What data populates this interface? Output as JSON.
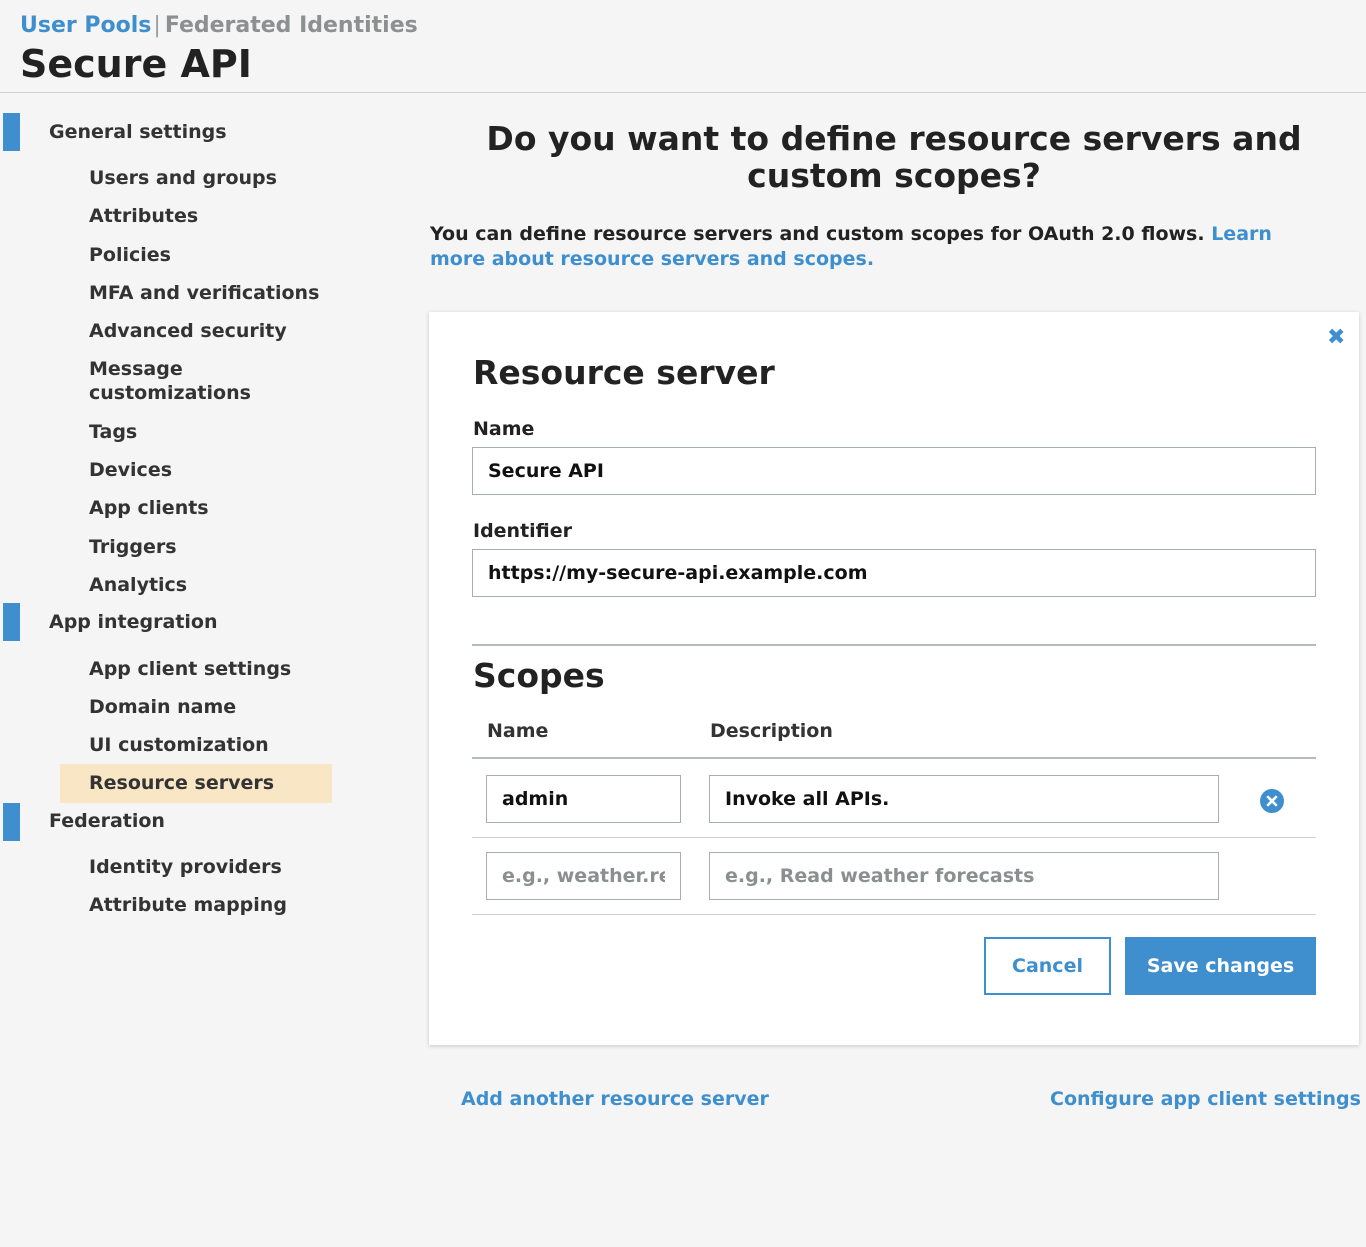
{
  "header": {
    "tabs": [
      {
        "label": "User Pools",
        "active": true
      },
      {
        "label": "Federated Identities",
        "active": false
      }
    ],
    "separator": "|",
    "pool_name": "Secure API"
  },
  "sidebar": {
    "groups": [
      {
        "label": "General settings",
        "items": [
          "Users and groups",
          "Attributes",
          "Policies",
          "MFA and verifications",
          "Advanced security",
          "Message customizations",
          "Tags",
          "Devices",
          "App clients",
          "Triggers",
          "Analytics"
        ]
      },
      {
        "label": "App integration",
        "items": [
          "App client settings",
          "Domain name",
          "UI customization",
          "Resource servers"
        ]
      },
      {
        "label": "Federation",
        "items": [
          "Identity providers",
          "Attribute mapping"
        ]
      }
    ],
    "selected": "Resource servers",
    "colors": {
      "marker": "#3f8fce",
      "selected_bg": "#f8e6c5"
    }
  },
  "main": {
    "headline": "Do you want to define resource servers and custom scopes?",
    "intro_text": "You can define resource servers and custom scopes for OAuth 2.0 flows.",
    "intro_link": "Learn more about resource servers and scopes.",
    "resource_server": {
      "title": "Resource server",
      "name_label": "Name",
      "name_value": "Secure API",
      "identifier_label": "Identifier",
      "identifier_value": "https://my-secure-api.example.com",
      "close_icon": "close-icon"
    },
    "scopes": {
      "title": "Scopes",
      "col_name": "Name",
      "col_description": "Description",
      "rows": [
        {
          "name": "admin",
          "description": "Invoke all APIs.",
          "remove_icon": "remove-circle-icon"
        }
      ],
      "new_row": {
        "name_placeholder": "e.g., weather.read",
        "description_placeholder": "e.g., Read weather forecasts"
      }
    },
    "buttons": {
      "cancel": "Cancel",
      "save": "Save changes"
    },
    "links": {
      "add_another": "Add another resource server",
      "configure": "Configure app client settings"
    },
    "colors": {
      "accent": "#3f8fce",
      "background": "#f4f5f4"
    }
  }
}
